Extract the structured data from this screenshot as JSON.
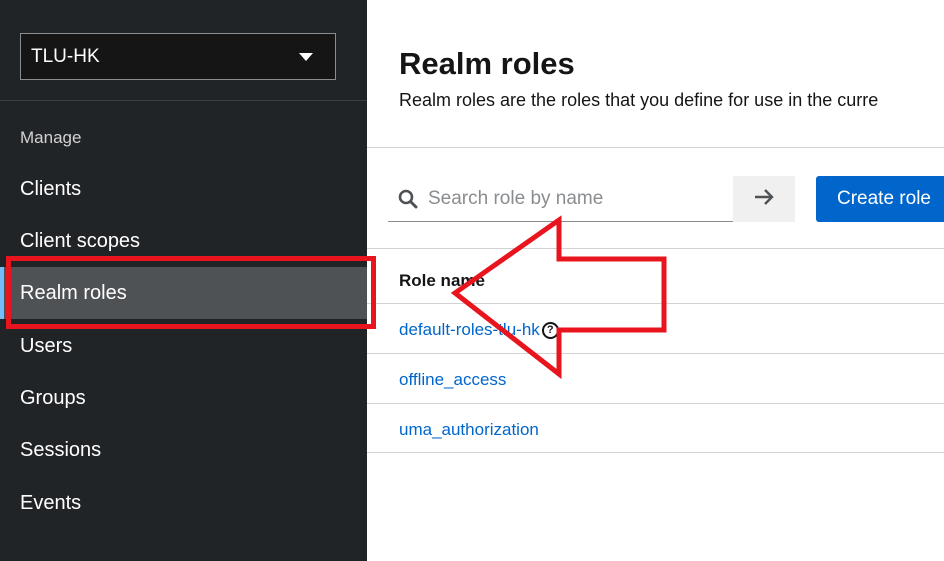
{
  "sidebar": {
    "realm": "TLU-HK",
    "group_title": "Manage",
    "items": [
      {
        "label": "Clients"
      },
      {
        "label": "Client scopes"
      },
      {
        "label": "Realm roles"
      },
      {
        "label": "Users"
      },
      {
        "label": "Groups"
      },
      {
        "label": "Sessions"
      },
      {
        "label": "Events"
      }
    ]
  },
  "main": {
    "title": "Realm roles",
    "description": "Realm roles are the roles that you define for use in the curre",
    "search": {
      "placeholder": "Search role by name",
      "value": ""
    },
    "create_button": "Create role",
    "table": {
      "column_header": "Role name",
      "rows": [
        {
          "name": "default-roles-tlu-hk"
        },
        {
          "name": "offline_access"
        },
        {
          "name": "uma_authorization"
        }
      ]
    }
  },
  "annotations": {
    "color": "#e8141e"
  },
  "colors": {
    "sidebar_bg": "#212427",
    "active_item_bg": "#4f5255",
    "primary": "#0066cc",
    "link": "#0066cc"
  },
  "icons": {
    "search": "search-icon",
    "submit": "arrow-right-icon",
    "help": "question-circle-icon",
    "dropdown": "caret-down-icon"
  }
}
